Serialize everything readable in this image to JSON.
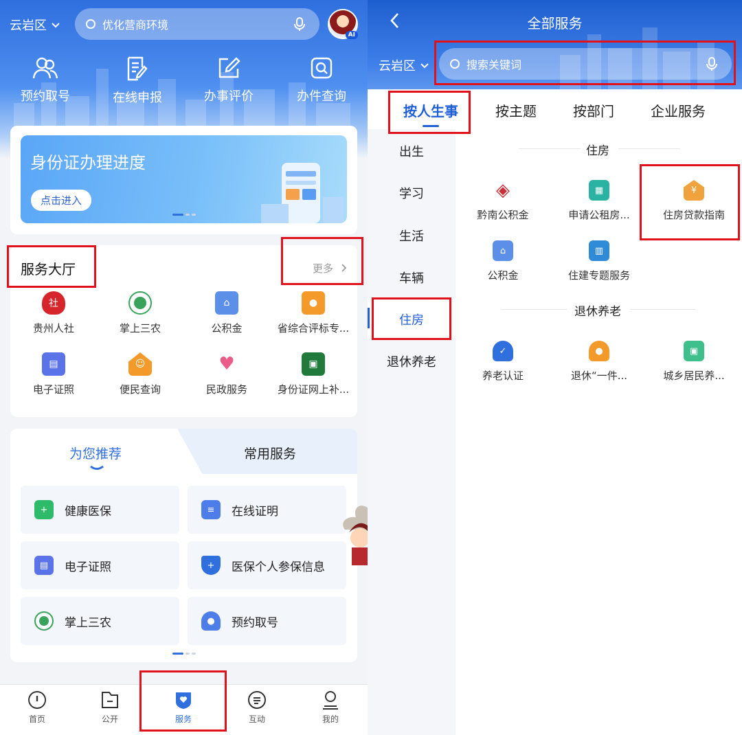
{
  "left": {
    "location": "云岩区",
    "search_placeholder": "优化营商环境",
    "avatar_badge": "AI",
    "quick_actions": [
      {
        "label": "预约取号",
        "icon": "people-icon"
      },
      {
        "label": "在线申报",
        "icon": "document-edit-icon"
      },
      {
        "label": "办事评价",
        "icon": "pencil-square-icon"
      },
      {
        "label": "办件查询",
        "icon": "search-square-icon"
      }
    ],
    "banner": {
      "title": "身份证办理进度",
      "button": "点击进入"
    },
    "hall": {
      "title": "服务大厅",
      "more": "更多",
      "items": [
        {
          "label": "贵州人社",
          "icon": "guizhou-hrss-icon",
          "color": "#d7262b"
        },
        {
          "label": "掌上三农",
          "icon": "sannong-icon",
          "color": "#3aa35b"
        },
        {
          "label": "公积金",
          "icon": "housing-fund-icon",
          "color": "#5b8fe8"
        },
        {
          "label": "省综合评标专...",
          "icon": "expert-icon",
          "color": "#f39a2a"
        },
        {
          "label": "电子证照",
          "icon": "id-card-icon",
          "color": "#5b73e8"
        },
        {
          "label": "便民查询",
          "icon": "smile-house-icon",
          "color": "#f39a2a"
        },
        {
          "label": "民政服务",
          "icon": "civil-affairs-icon",
          "color": "#ea5c8a"
        },
        {
          "label": "身份证网上补...",
          "icon": "id-reissue-icon",
          "color": "#1f7a3c"
        }
      ]
    },
    "recommend": {
      "tab_active": "为您推荐",
      "tab_other": "常用服务",
      "items": [
        {
          "label": "健康医保",
          "icon": "health-insurance-icon",
          "color": "#2dbb6a"
        },
        {
          "label": "在线证明",
          "icon": "certificate-icon",
          "color": "#4c7de8"
        },
        {
          "label": "电子证照",
          "icon": "id-card-icon",
          "color": "#5b73e8"
        },
        {
          "label": "医保个人参保信息",
          "icon": "shield-plus-icon",
          "color": "#2f6fde"
        },
        {
          "label": "掌上三农",
          "icon": "sannong-icon",
          "color": "#3aa35b"
        },
        {
          "label": "预约取号",
          "icon": "person-icon",
          "color": "#4c7de8"
        }
      ]
    },
    "tabbar": [
      {
        "label": "首页",
        "icon": "home-icon"
      },
      {
        "label": "公开",
        "icon": "folder-icon"
      },
      {
        "label": "服务",
        "icon": "heart-shield-icon"
      },
      {
        "label": "互动",
        "icon": "chat-icon"
      },
      {
        "label": "我的",
        "icon": "user-icon"
      }
    ],
    "active_tab": "服务"
  },
  "right": {
    "title": "全部服务",
    "location": "云岩区",
    "search_placeholder": "搜索关键词",
    "tabs": [
      "按人生事",
      "按主题",
      "按部门",
      "企业服务"
    ],
    "active_tab": "按人生事",
    "sidebar": [
      "出生",
      "学习",
      "生活",
      "车辆",
      "住房",
      "退休养老"
    ],
    "active_sidebar": "住房",
    "sections": [
      {
        "title": "住房",
        "items": [
          {
            "label": "黔南公积金",
            "icon": "qiannan-fund-icon",
            "color": "#c8303a"
          },
          {
            "label": "申请公租房...",
            "icon": "building-icon",
            "color": "#2ab3a3"
          },
          {
            "label": "住房贷款指南",
            "icon": "house-loan-icon",
            "color": "#f0a23c"
          },
          {
            "label": "公积金",
            "icon": "housing-fund-icon",
            "color": "#5b8fe8"
          },
          {
            "label": "住建专题服务",
            "icon": "tower-icon",
            "color": "#2f8ad8"
          }
        ]
      },
      {
        "title": "退休养老",
        "items": [
          {
            "label": "养老认证",
            "icon": "pension-verify-icon",
            "color": "#2f6fde"
          },
          {
            "label": "退休“一件...",
            "icon": "elder-icon",
            "color": "#f39a2a"
          },
          {
            "label": "城乡居民养...",
            "icon": "pension-card-icon",
            "color": "#3fbf8c"
          }
        ]
      }
    ]
  },
  "highlight_color": "#e1111b",
  "accent_color": "#2f6fde"
}
